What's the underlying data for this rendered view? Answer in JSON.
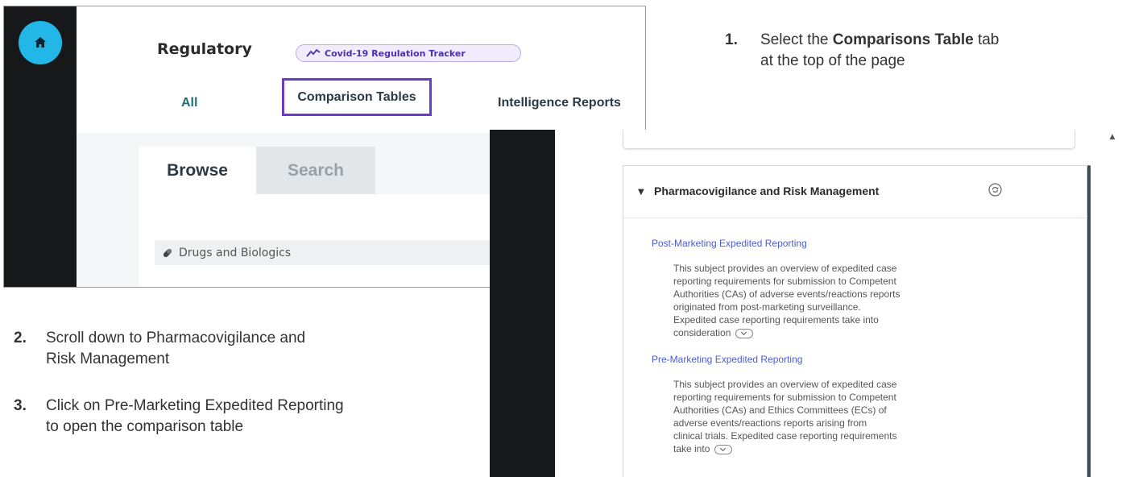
{
  "regulatory": {
    "title": "Regulatory",
    "tracker_label": "Covid-19 Regulation Tracker",
    "tabs": {
      "all": "All",
      "comparison_tables": "Comparison Tables",
      "intelligence_reports": "Intelligence Reports"
    },
    "browse_label": "Browse",
    "search_label": "Search",
    "drugs_label": "Drugs and Biologics"
  },
  "panel": {
    "section_title": "Pharmacovigilance and Risk Management",
    "subjects": [
      {
        "title": "Post-Marketing Expedited Reporting",
        "lines": [
          "This subject provides an overview of expedited case",
          "reporting requirements for submission to Competent",
          "Authorities (CAs) of adverse events/reactions reports",
          "originated from post-marketing surveillance.",
          "Expedited case reporting requirements take into",
          "consideration"
        ]
      },
      {
        "title": "Pre-Marketing Expedited Reporting",
        "lines": [
          "This subject provides an overview of expedited case",
          "reporting requirements for submission to Competent",
          "Authorities (CAs) and Ethics Committees (ECs) of",
          "adverse events/reactions reports arising from",
          "clinical trials. Expedited case reporting requirements",
          "take into"
        ]
      }
    ]
  },
  "instructions": {
    "step1": {
      "num": "1.",
      "pre": "Select the ",
      "bold": "Comparisons Table",
      "post": " tab",
      "line2": "at the top of the page"
    },
    "step2": {
      "num": "2.",
      "line1": "Scroll down to Pharmacovigilance and",
      "line2": "Risk Management"
    },
    "step3": {
      "num": "3.",
      "line1": "Click on Pre-Marketing Expedited Reporting",
      "line2": "to open the comparison table"
    }
  },
  "icons": {
    "home": "home-icon",
    "tracker": "trend-line-icon",
    "pill": "pill-icon",
    "refresh": "refresh-icon",
    "caret": "caret-down-icon"
  },
  "colors": {
    "home_button": "#22b7e6",
    "highlight_border": "#6a3bc9",
    "link": "#4b5cd8",
    "sidebar": "#161819"
  }
}
